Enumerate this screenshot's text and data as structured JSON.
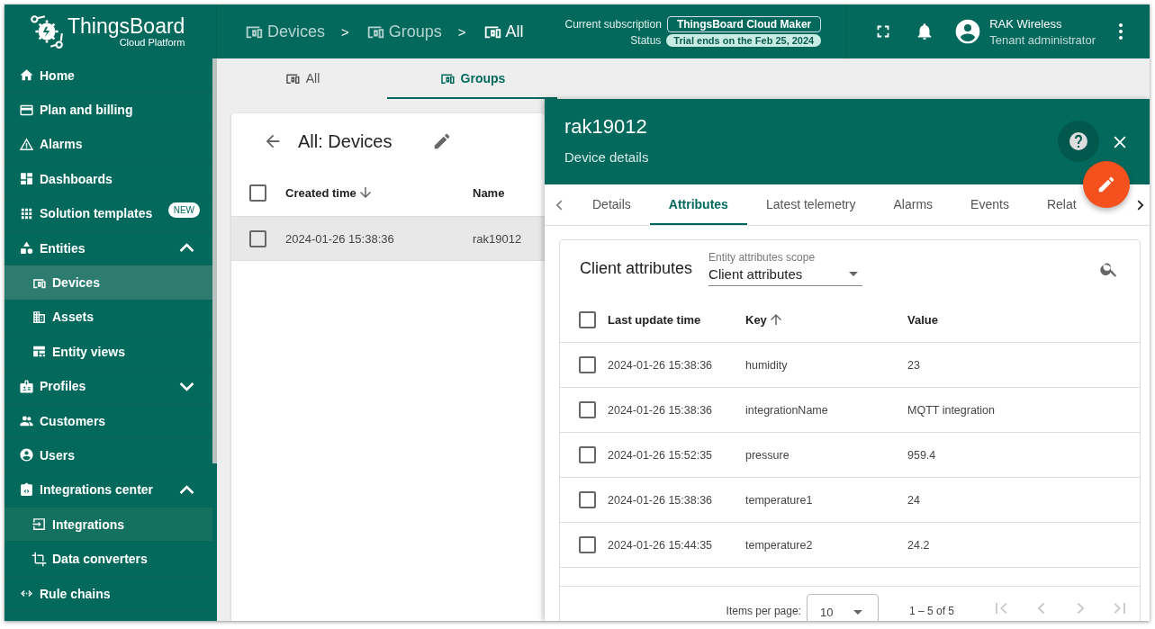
{
  "logo": {
    "title": "ThingsBoard",
    "subtitle": "Cloud Platform"
  },
  "breadcrumb": [
    {
      "label": "Devices",
      "current": false
    },
    {
      "label": "Groups",
      "current": false
    },
    {
      "label": "All",
      "current": true
    }
  ],
  "breadcrumb_separator": ">",
  "subscription": {
    "label": "Current subscription",
    "plan": "ThingsBoard Cloud Maker",
    "status_label": "Status",
    "status": "Trial ends on the Feb 25, 2024"
  },
  "user": {
    "name": "RAK Wireless",
    "role": "Tenant administrator"
  },
  "sidebar": {
    "items": [
      {
        "label": "Home",
        "selected": false
      },
      {
        "label": "Plan and billing",
        "selected": false
      },
      {
        "label": "Alarms",
        "selected": false
      },
      {
        "label": "Dashboards",
        "selected": false
      },
      {
        "label": "Solution templates",
        "selected": false,
        "badge": "NEW"
      },
      {
        "label": "Entities",
        "selected": false,
        "expanded": true,
        "children": [
          {
            "label": "Devices",
            "selected": true,
            "hovered": false
          },
          {
            "label": "Assets",
            "selected": false,
            "hovered": false
          },
          {
            "label": "Entity views",
            "selected": false,
            "hovered": false
          }
        ]
      },
      {
        "label": "Profiles",
        "selected": false,
        "expanded": false
      },
      {
        "label": "Customers",
        "selected": false
      },
      {
        "label": "Users",
        "selected": false
      },
      {
        "label": "Integrations center",
        "selected": false,
        "expanded": true,
        "children": [
          {
            "label": "Integrations",
            "selected": false,
            "hovered": true
          },
          {
            "label": "Data converters",
            "selected": false,
            "hovered": false
          }
        ]
      },
      {
        "label": "Rule chains",
        "selected": false
      }
    ]
  },
  "group_tabs": [
    {
      "label": "All",
      "selected": false
    },
    {
      "label": "Groups",
      "selected": true
    }
  ],
  "devices_table": {
    "title": "All: Devices",
    "columns": [
      {
        "label": "Created time",
        "sorted": true,
        "descending": true
      },
      {
        "label": "Name",
        "sorted": false
      }
    ],
    "all_checked": false,
    "rows": [
      {
        "cells": [
          "2024-01-26 15:38:36",
          "rak19012"
        ],
        "checked": false,
        "highlighted": true
      }
    ]
  },
  "details": {
    "title": "rak19012",
    "subtitle": "Device details",
    "tabs": [
      {
        "label": "Details",
        "selected": false
      },
      {
        "label": "Attributes",
        "selected": true
      },
      {
        "label": "Latest telemetry",
        "selected": false
      },
      {
        "label": "Alarms",
        "selected": false
      },
      {
        "label": "Events",
        "selected": false
      },
      {
        "label": "Relat",
        "selected": false
      }
    ],
    "attributes": {
      "title": "Client attributes",
      "scope": {
        "label": "Entity attributes scope",
        "value": "Client attributes"
      },
      "columns": [
        {
          "label": "Last update time",
          "sorted": false
        },
        {
          "label": "Key",
          "sorted": true,
          "descending": false
        },
        {
          "label": "Value",
          "sorted": false
        }
      ],
      "all_checked": false,
      "rows": [
        {
          "cells": [
            "2024-01-26 15:38:36",
            "humidity",
            "23"
          ],
          "checked": false
        },
        {
          "cells": [
            "2024-01-26 15:38:36",
            "integrationName",
            "MQTT integration"
          ],
          "checked": false
        },
        {
          "cells": [
            "2024-01-26 15:52:35",
            "pressure",
            "959.4"
          ],
          "checked": false
        },
        {
          "cells": [
            "2024-01-26 15:38:36",
            "temperature1",
            "24"
          ],
          "checked": false
        },
        {
          "cells": [
            "2024-01-26 15:44:35",
            "temperature2",
            "24.2"
          ],
          "checked": false
        }
      ],
      "paginator": {
        "label": "Items per page:",
        "page_size": "10",
        "range": "1 – 5 of 5"
      }
    }
  }
}
